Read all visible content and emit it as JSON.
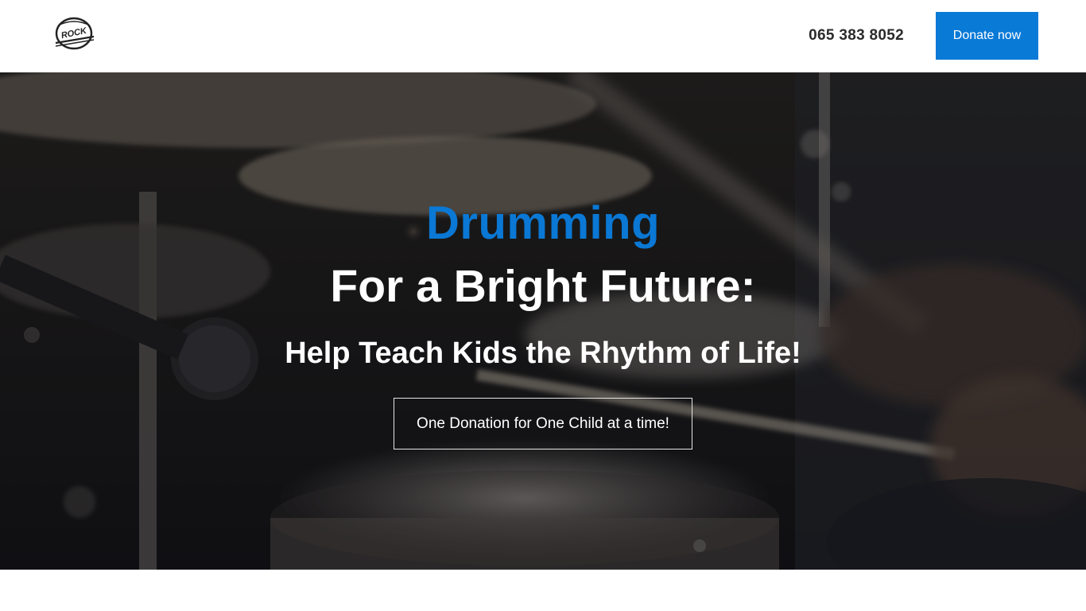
{
  "header": {
    "logo_text": "ROCK",
    "phone": "065 383 8052",
    "donate_label": "Donate now"
  },
  "hero": {
    "headline_accent": "Drumming",
    "headline": "For a Bright Future:",
    "subheadline": "Help Teach Kids the Rhythm of Life!",
    "cta_label": "One Donation for One Child at a time!"
  },
  "colors": {
    "accent": "#0a78d4",
    "button": "#0a7ad7",
    "text_dark": "#2b2b2b",
    "text_light": "#ffffff"
  },
  "icons": {
    "logo": "drum-logo-icon"
  }
}
